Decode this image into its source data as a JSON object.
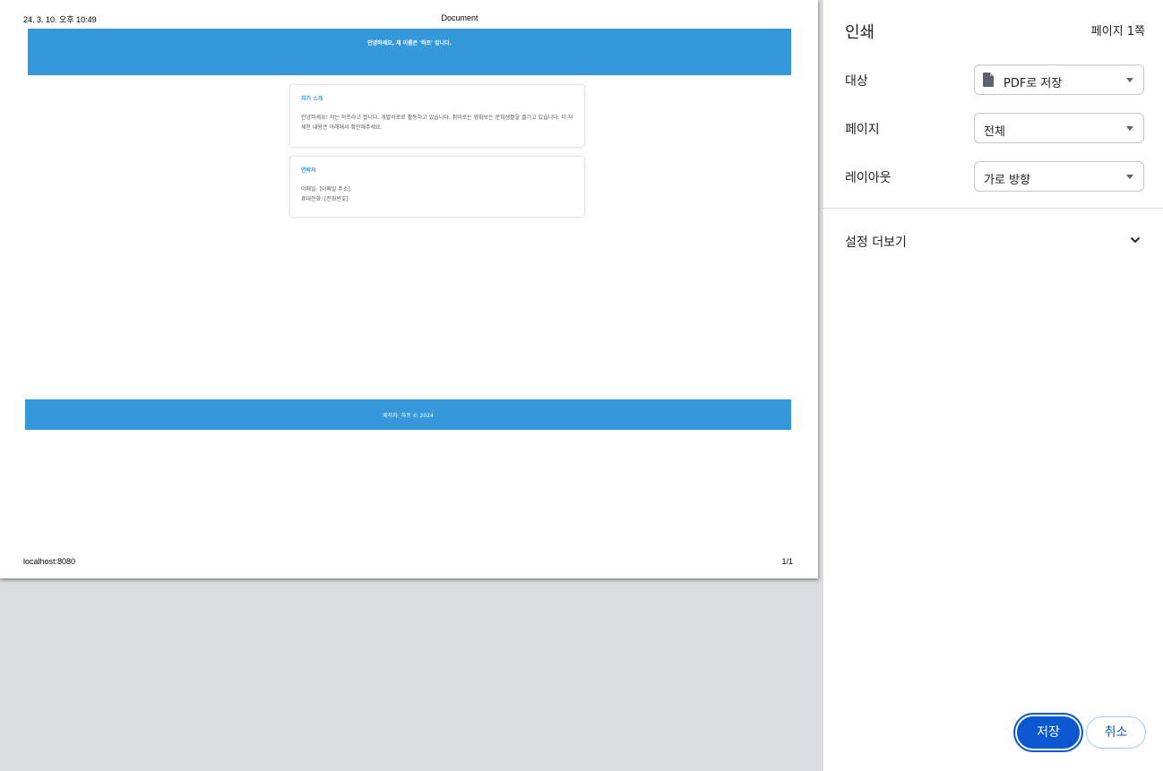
{
  "preview": {
    "header_date": "24. 3. 10. 오후 10:49",
    "header_title": "Document",
    "footer_url": "localhost:8080",
    "footer_pages": "1/1",
    "site": {
      "greeting": "안녕하세요, 제 이름은 '하프' 입니다.",
      "intro_title": "자기 소개",
      "intro_text": "안녕하세요! 저는 하프라고 합니다. 개발자로로 활동하고 있습니다. 취미로는 영화보는 문화생활을 즐기고 있습니다. 더 자세한 내용은 아래에서 확인해주세요.",
      "contact_title": "연락처",
      "contact_email": "이메일: [이메일 주소]",
      "contact_phone": "휴대전화: [전화번호]",
      "footer_text": "제작자: 하프 © 2024"
    },
    "colors": {
      "accent": "#3498db",
      "page_bg": "#dadce0"
    }
  },
  "panel": {
    "title": "인쇄",
    "page_count": "페이지 1쪽",
    "destination": {
      "label": "대상",
      "value": "PDF로 저장",
      "icon": "file-icon"
    },
    "pages": {
      "label": "페이지",
      "value": "전체"
    },
    "layout": {
      "label": "레이아웃",
      "value": "가로 방향"
    },
    "more_settings": {
      "label": "설정 더보기",
      "icon": "chevron-down-icon"
    },
    "save_label": "저장",
    "cancel_label": "취소",
    "colors": {
      "primary": "#0b57d0"
    }
  }
}
